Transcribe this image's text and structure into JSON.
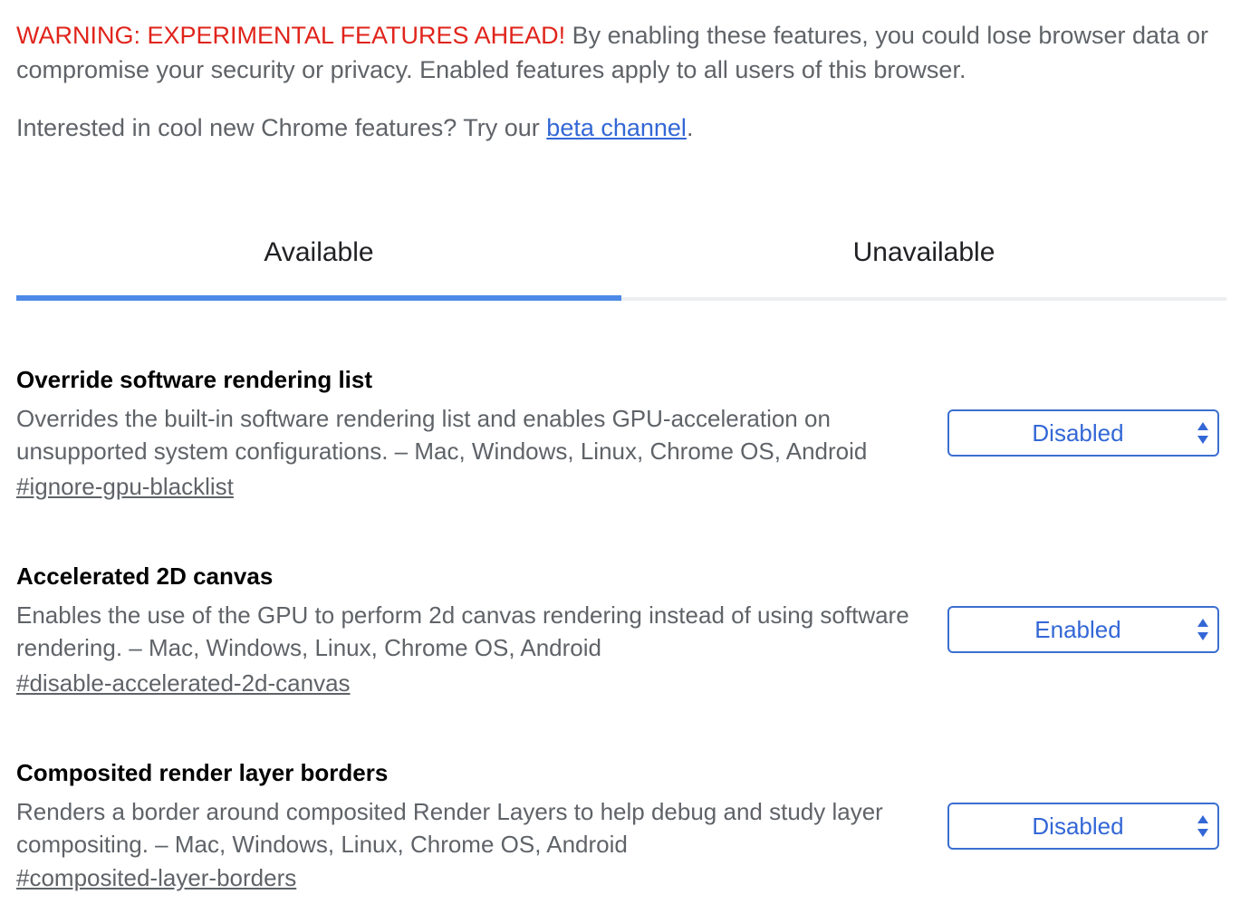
{
  "header": {
    "warning_prefix": "WARNING: EXPERIMENTAL FEATURES AHEAD!",
    "warning_text": " By enabling these features, you could lose browser data or compromise your security or privacy. Enabled features apply to all users of this browser.",
    "beta_prefix": "Interested in cool new Chrome features? Try our ",
    "beta_link": "beta channel",
    "beta_suffix": "."
  },
  "tabs": {
    "available": "Available",
    "unavailable": "Unavailable",
    "selected": "Available"
  },
  "experiments": [
    {
      "title": "Override software rendering list",
      "description": "Overrides the built-in software rendering list and enables GPU-acceleration on unsupported system configurations. – Mac, Windows, Linux, Chrome OS, Android",
      "link": "#ignore-gpu-blacklist",
      "value": "Disabled"
    },
    {
      "title": "Accelerated 2D canvas",
      "description": "Enables the use of the GPU to perform 2d canvas rendering instead of using software rendering. – Mac, Windows, Linux, Chrome OS, Android",
      "link": "#disable-accelerated-2d-canvas",
      "value": "Enabled"
    },
    {
      "title": "Composited render layer borders",
      "description": "Renders a border around composited Render Layers to help debug and study layer compositing. – Mac, Windows, Linux, Chrome OS, Android",
      "link": "#composited-layer-borders",
      "value": "Disabled"
    }
  ],
  "colors": {
    "warning": "#e0241b",
    "link": "#3367d6",
    "tab_indicator": "#4d8ae8",
    "select_border": "#3b6fd0"
  }
}
